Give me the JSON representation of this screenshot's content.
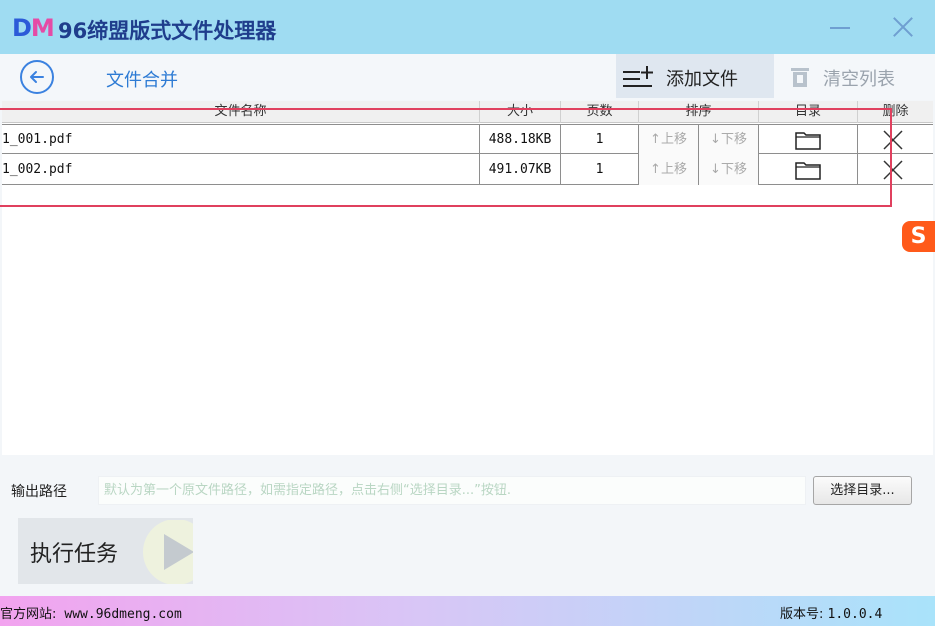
{
  "app": {
    "logo_d": "D",
    "logo_m": "M",
    "title": "96缔盟版式文件处理器"
  },
  "toolbar": {
    "page_label": "文件合并",
    "add_files": "添加文件",
    "clear_list": "清空列表"
  },
  "table": {
    "headers": {
      "name": "文件名称",
      "size": "大小",
      "pages": "页数",
      "sort": "排序",
      "directory": "目录",
      "delete": "删除"
    },
    "move_up": "↑上移",
    "move_down": "↓下移",
    "rows": [
      {
        "name": "1_001.pdf",
        "size": "488.18KB",
        "pages": "1"
      },
      {
        "name": "1_002.pdf",
        "size": "491.07KB",
        "pages": "1"
      }
    ]
  },
  "output": {
    "label": "输出路径",
    "value": "",
    "placeholder": "默认为第一个原文件路径，如需指定路径，点击右侧“选择目录...”按钮.",
    "choose_button": "选择目录..."
  },
  "run": {
    "label": "执行任务"
  },
  "status": {
    "website_label": "官方网站:",
    "website_url": "www.96dmeng.com",
    "version_label": "版本号:",
    "version": "1.0.0.4"
  },
  "side_icon": {
    "glyph": "S"
  },
  "colors": {
    "titlebar": "#9fdcf2",
    "accent_blue": "#2d7bd4",
    "highlight_red": "#e0405e",
    "placeholder_green": "#b9d6c3"
  }
}
